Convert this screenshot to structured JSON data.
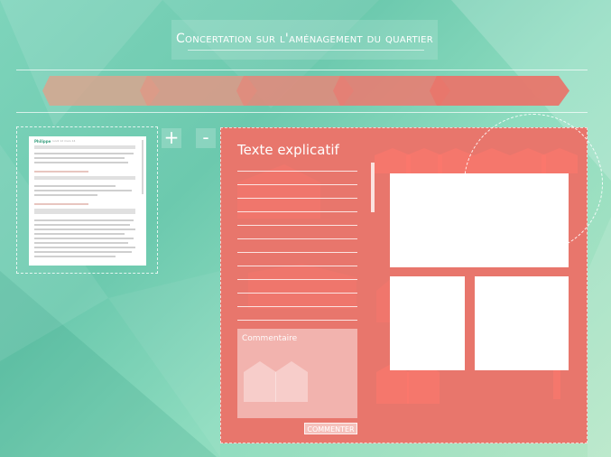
{
  "header": {
    "title": "Concertation sur l'aménagement du quartier"
  },
  "steps": {
    "count_label": "",
    "colors": [
      "#d8a58e",
      "#dd9886",
      "#e08b7c",
      "#e57f74",
      "#e8766c"
    ]
  },
  "thumbnail": {
    "author": "Philippe",
    "meta": "lundi 12 mars 14",
    "comments": [
      "Souhaiteriez-vous un parc plus grand ?",
      "Le Crozet (Léonie Grangier)",
      "Comment les lieux de rencontre pourraient ..."
    ]
  },
  "zoom": {
    "plus_label": "+",
    "minus_label": "-"
  },
  "panel": {
    "title": "Texte explicatif",
    "comment_placeholder": "Commentaire",
    "comment_button": "COMMENTER"
  },
  "colors": {
    "panel": "#e8766c",
    "background": "#7ed4bb"
  }
}
